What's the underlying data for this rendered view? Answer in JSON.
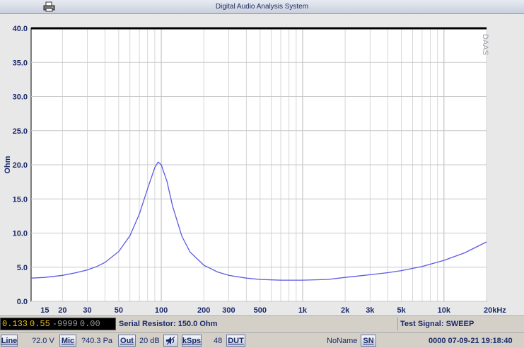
{
  "window": {
    "title": "Digital Audio Analysis System"
  },
  "icons": {
    "print": "printer-icon",
    "speaker": "speaker-icon"
  },
  "colors": {
    "curve": "#5a5ae6",
    "axis": "#1a2a6c",
    "grid": "#c8c8c8",
    "meter_text": "#e8c020"
  },
  "chart_data": {
    "type": "line",
    "title": "",
    "ylabel": "Ohm",
    "xlabel": "",
    "x_scale": "log",
    "xlim": [
      12,
      20000
    ],
    "ylim": [
      0,
      40
    ],
    "grid": true,
    "watermark": "DAAS",
    "x_ticks": [
      {
        "v": 15,
        "label": "15"
      },
      {
        "v": 20,
        "label": "20"
      },
      {
        "v": 30,
        "label": "30"
      },
      {
        "v": 50,
        "label": "50"
      },
      {
        "v": 100,
        "label": "100"
      },
      {
        "v": 200,
        "label": "200"
      },
      {
        "v": 300,
        "label": "300"
      },
      {
        "v": 500,
        "label": "500"
      },
      {
        "v": 1000,
        "label": "1k"
      },
      {
        "v": 2000,
        "label": "2k"
      },
      {
        "v": 3000,
        "label": "3k"
      },
      {
        "v": 5000,
        "label": "5k"
      },
      {
        "v": 10000,
        "label": "10k"
      },
      {
        "v": 20000,
        "label": "20kHz"
      }
    ],
    "y_ticks": [
      "0.0",
      "5.0",
      "10.0",
      "15.0",
      "20.0",
      "25.0",
      "30.0",
      "35.0",
      "40.0"
    ],
    "series": [
      {
        "x": [
          12,
          15,
          20,
          25,
          30,
          35,
          40,
          50,
          60,
          70,
          80,
          90,
          95,
          100,
          110,
          120,
          140,
          160,
          200,
          250,
          300,
          400,
          500,
          700,
          1000,
          1500,
          2000,
          3000,
          4000,
          5000,
          7000,
          10000,
          14000,
          20000
        ],
        "y": [
          3.4,
          3.5,
          3.8,
          4.2,
          4.6,
          5.1,
          5.7,
          7.3,
          9.6,
          12.8,
          16.5,
          19.6,
          20.4,
          20.0,
          17.5,
          14.0,
          9.5,
          7.2,
          5.3,
          4.3,
          3.8,
          3.4,
          3.2,
          3.1,
          3.1,
          3.2,
          3.5,
          3.9,
          4.2,
          4.5,
          5.1,
          6.0,
          7.1,
          8.7
        ]
      }
    ]
  },
  "meter": {
    "seg1": "0.133",
    "seg2": "0.55",
    "seg3": "-9999",
    "seg4": "0.00"
  },
  "status": {
    "serial_resistor": "Serial Resistor: 150.0 Ohm",
    "test_signal": "Test Signal: SWEEP"
  },
  "controls": {
    "line": "Line",
    "voltage": "?2.0 V",
    "mic": "Mic",
    "pressure": "?40.3 Pa",
    "out": "Out",
    "gain": "20 dB",
    "ksps": "kSps",
    "rate": "48",
    "dut": "DUT",
    "name": "NoName",
    "sn": "SN",
    "timestamp": "0000 07-09-21 19:18:40"
  }
}
